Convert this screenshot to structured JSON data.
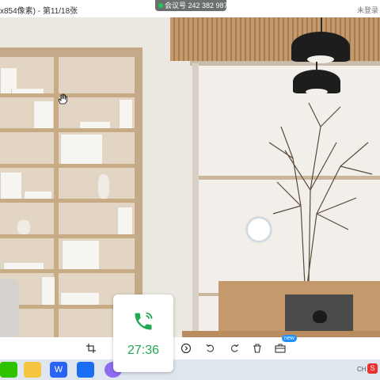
{
  "window": {
    "title": "x854像素) - 第11/18张",
    "status_right": "未登录"
  },
  "meeting": {
    "label": "会议号 242 382 987",
    "status_color": "#22c55e"
  },
  "toolbar": {
    "badge": "new",
    "icons": [
      "crop-icon",
      "play-circle-icon",
      "rotate-left-icon",
      "rotate-right-icon",
      "trash-icon",
      "toolbox-icon"
    ]
  },
  "call": {
    "timer": "27:36",
    "icon": "phone-icon",
    "accent": "#1faa52"
  },
  "taskbar": {
    "apps": [
      "wechat-icon",
      "folder-icon",
      "wps-icon",
      "meeting-app-icon",
      "browser-icon"
    ],
    "tray": "CH",
    "tray_icon": "sogou-input-icon"
  }
}
